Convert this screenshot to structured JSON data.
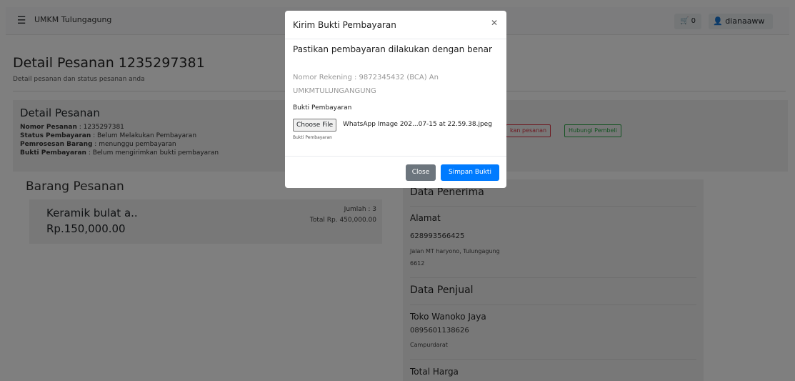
{
  "navbar": {
    "menu_icon": "menu-icon",
    "brand": "UMKM Tulungagung",
    "cart_count": "0",
    "username": "dianaaww"
  },
  "page": {
    "title": "Detail Pesanan 1235297381",
    "subtitle": "Detail pesanan dan status pesanan anda"
  },
  "detail": {
    "heading": "Detail Pesanan",
    "nomor_label": "Nomor Pesanan",
    "nomor_value": " : 1235297381",
    "status_label": "Status Pembayaran",
    "status_value": " : Belum Melakukan Pembayaran",
    "proses_label": "Pemrosesan Barang",
    "proses_value": " : menunggu pembayaran",
    "bukti_label": "Bukti Pembayaran",
    "bukti_value": " : Belum mengirimkan bukti pembayaran",
    "cancel_button": "kan pesanan",
    "contact_button": "Hubungi Pembeli"
  },
  "barang": {
    "heading": "Barang Pesanan",
    "items": [
      {
        "name": "Keramik bulat a..",
        "price": "Rp.150,000.00",
        "qty": "Jumlah : 3",
        "total": "Total Rp. 450,000.00"
      }
    ]
  },
  "penerima": {
    "heading": "Data Penerima",
    "alamat_label": "Alamat",
    "phone": "628993566425",
    "address": "Jalan MT haryono, Tulungagung",
    "postcode": "6612"
  },
  "penjual": {
    "heading": "Data Penjual",
    "store": "Toko Wanoko Jaya",
    "phone": "0895601138626",
    "city": "Campurdarat"
  },
  "total": {
    "heading": "Total Harga"
  },
  "modal": {
    "title": "Kirim Bukti Pembayaran",
    "close_icon": "close-icon",
    "warning": "Pastikan pembayaran dilakukan dengan benar",
    "rekening": "Nomor Rekening : 9872345432 (BCA) An UMKMTULUNGANGUNG",
    "file_label": "Bukti Pembayaran",
    "file_button": "Choose File",
    "file_name": "WhatsApp Image 202...07-15 at 22.59.38.jpeg",
    "help_text": "Bukti Pembayaran",
    "close_button": "Close",
    "save_button": "Simpan Bukti"
  },
  "colors": {
    "primary": "#007bff",
    "secondary": "#6c757d",
    "danger": "#dc3545",
    "success": "#28a745"
  }
}
